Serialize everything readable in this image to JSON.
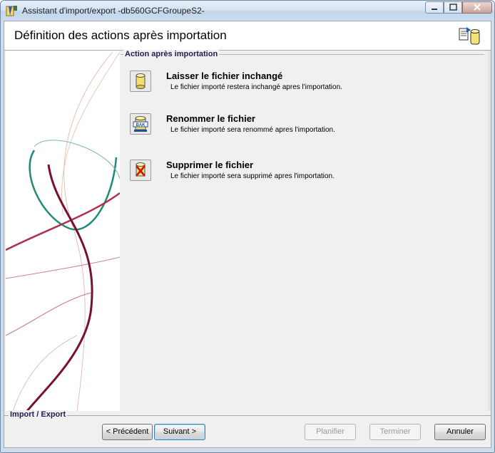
{
  "window": {
    "title": "Assistant d'import/export -db560GCFGroupeS2-",
    "app_icon": "wizard-app-icon",
    "controls": [
      "minimize-icon",
      "maximize-icon",
      "close-icon"
    ]
  },
  "header": {
    "title": "Définition des actions après importation",
    "icon": "import-export-icon"
  },
  "group": {
    "legend": "Action après importation"
  },
  "options": [
    {
      "icon": "database-icon",
      "title": "Laisser le fichier inchangé",
      "description": "Le fichier importé restera inchangé apres l'importation."
    },
    {
      "icon": "bak-database-icon",
      "title": "Renommer le fichier",
      "description": "Le fichier importé sera renommé apres l'importation."
    },
    {
      "icon": "delete-database-icon",
      "title": "Supprimer le fichier",
      "description": "Le fichier importé sera supprimé apres l'importation."
    }
  ],
  "footer": {
    "legend": "Import / Export"
  },
  "buttons": {
    "previous": "< Précédent",
    "next": "Suivant >",
    "plan": "Planifier",
    "finish": "Terminer",
    "cancel": "Annuler"
  },
  "colors": {
    "accent_teal": "#1f8a7a",
    "accent_maroon": "#7a1030",
    "titlebar": "#cbdcef"
  }
}
